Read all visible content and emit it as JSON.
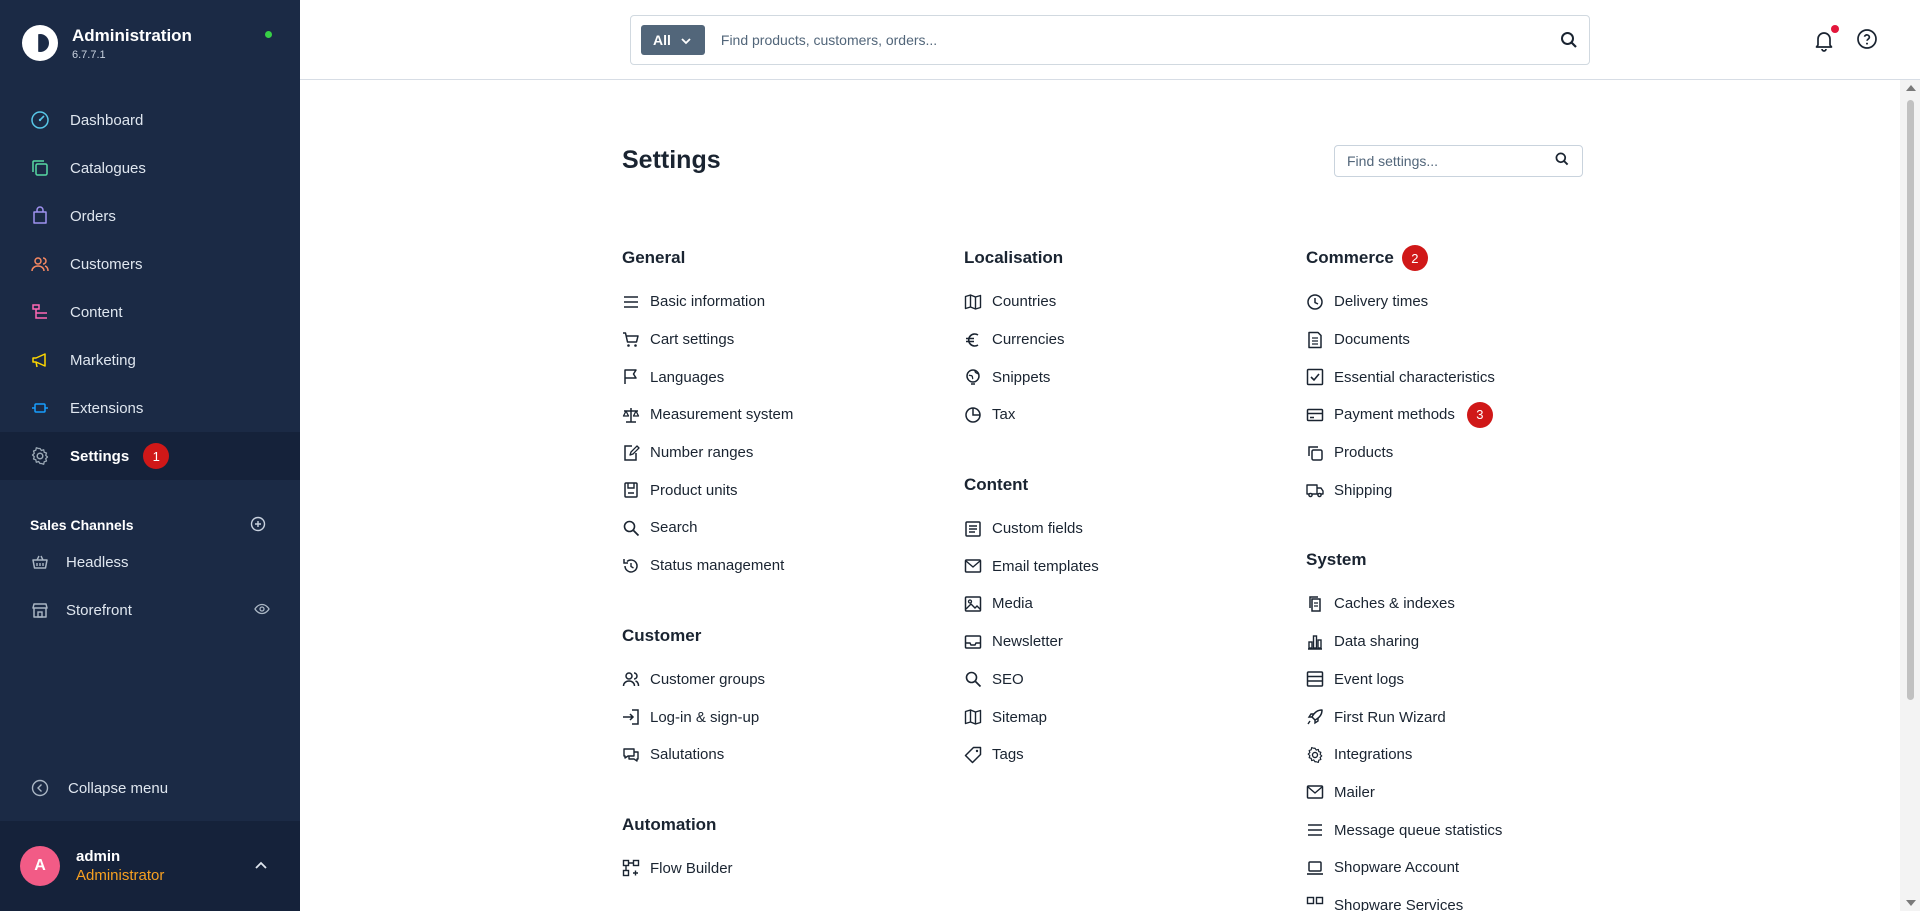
{
  "brand": {
    "title": "Administration",
    "version": "6.7.7.1"
  },
  "nav": [
    {
      "label": "Dashboard",
      "icon": "dashboard-icon",
      "color": "#58c7e8"
    },
    {
      "label": "Catalogues",
      "icon": "catalogue-icon",
      "color": "#57d9a3"
    },
    {
      "label": "Orders",
      "icon": "orders-icon",
      "color": "#a092f0"
    },
    {
      "label": "Customers",
      "icon": "customers-icon",
      "color": "#f88962"
    },
    {
      "label": "Content",
      "icon": "content-icon",
      "color": "#ff68b4"
    },
    {
      "label": "Marketing",
      "icon": "marketing-icon",
      "color": "#ffd700"
    },
    {
      "label": "Extensions",
      "icon": "extensions-icon",
      "color": "#189eff"
    },
    {
      "label": "Settings",
      "icon": "gear-icon",
      "color": "#9aa8b5",
      "badge": "1"
    }
  ],
  "sales_channels": {
    "title": "Sales Channels",
    "items": [
      {
        "label": "Headless",
        "icon": "basket-icon"
      },
      {
        "label": "Storefront",
        "icon": "storefront-icon"
      }
    ]
  },
  "collapse_label": "Collapse menu",
  "user": {
    "initial": "A",
    "name": "admin",
    "role": "Administrator"
  },
  "search": {
    "scope": "All",
    "placeholder": "Find products, customers, orders..."
  },
  "page": {
    "title": "Settings",
    "search_placeholder": "Find settings..."
  },
  "columns": [
    {
      "groups": [
        {
          "title": "General",
          "items": [
            {
              "label": "Basic information",
              "icon": "list-icon"
            },
            {
              "label": "Cart settings",
              "icon": "cart-icon"
            },
            {
              "label": "Languages",
              "icon": "flag-icon"
            },
            {
              "label": "Measurement system",
              "icon": "scale-icon"
            },
            {
              "label": "Number ranges",
              "icon": "edit-document-icon"
            },
            {
              "label": "Product units",
              "icon": "product-unit-icon"
            },
            {
              "label": "Search",
              "icon": "search-icon"
            },
            {
              "label": "Status management",
              "icon": "history-icon"
            }
          ]
        },
        {
          "title": "Customer",
          "items": [
            {
              "label": "Customer groups",
              "icon": "users-icon"
            },
            {
              "label": "Log-in & sign-up",
              "icon": "sign-in-icon"
            },
            {
              "label": "Salutations",
              "icon": "chat-icon"
            }
          ]
        },
        {
          "title": "Automation",
          "items": [
            {
              "label": "Flow Builder",
              "icon": "flow-icon"
            }
          ]
        }
      ]
    },
    {
      "groups": [
        {
          "title": "Localisation",
          "items": [
            {
              "label": "Countries",
              "icon": "map-icon"
            },
            {
              "label": "Currencies",
              "icon": "euro-icon"
            },
            {
              "label": "Snippets",
              "icon": "globe-icon"
            },
            {
              "label": "Tax",
              "icon": "pie-chart-icon"
            }
          ]
        },
        {
          "title": "Content",
          "items": [
            {
              "label": "Custom fields",
              "icon": "custom-fields-icon"
            },
            {
              "label": "Email templates",
              "icon": "envelope-icon"
            },
            {
              "label": "Media",
              "icon": "image-icon"
            },
            {
              "label": "Newsletter",
              "icon": "inbox-icon"
            },
            {
              "label": "SEO",
              "icon": "search-icon"
            },
            {
              "label": "Sitemap",
              "icon": "map-icon"
            },
            {
              "label": "Tags",
              "icon": "tag-icon"
            }
          ]
        }
      ]
    },
    {
      "groups": [
        {
          "title": "Commerce",
          "badge": "2",
          "items": [
            {
              "label": "Delivery times",
              "icon": "clock-icon"
            },
            {
              "label": "Documents",
              "icon": "document-icon"
            },
            {
              "label": "Essential characteristics",
              "icon": "checkbox-icon"
            },
            {
              "label": "Payment methods",
              "icon": "credit-card-icon",
              "badge": "3"
            },
            {
              "label": "Products",
              "icon": "products-icon"
            },
            {
              "label": "Shipping",
              "icon": "truck-icon"
            }
          ]
        },
        {
          "title": "System",
          "items": [
            {
              "label": "Caches & indexes",
              "icon": "cache-icon"
            },
            {
              "label": "Data sharing",
              "icon": "bar-chart-icon"
            },
            {
              "label": "Event logs",
              "icon": "server-icon"
            },
            {
              "label": "First Run Wizard",
              "icon": "rocket-icon"
            },
            {
              "label": "Integrations",
              "icon": "gear-icon"
            },
            {
              "label": "Mailer",
              "icon": "envelope-icon"
            },
            {
              "label": "Message queue statistics",
              "icon": "list-icon"
            },
            {
              "label": "Shopware Account",
              "icon": "laptop-icon"
            },
            {
              "label": "Shopware Services",
              "icon": "services-icon"
            }
          ]
        }
      ]
    }
  ]
}
